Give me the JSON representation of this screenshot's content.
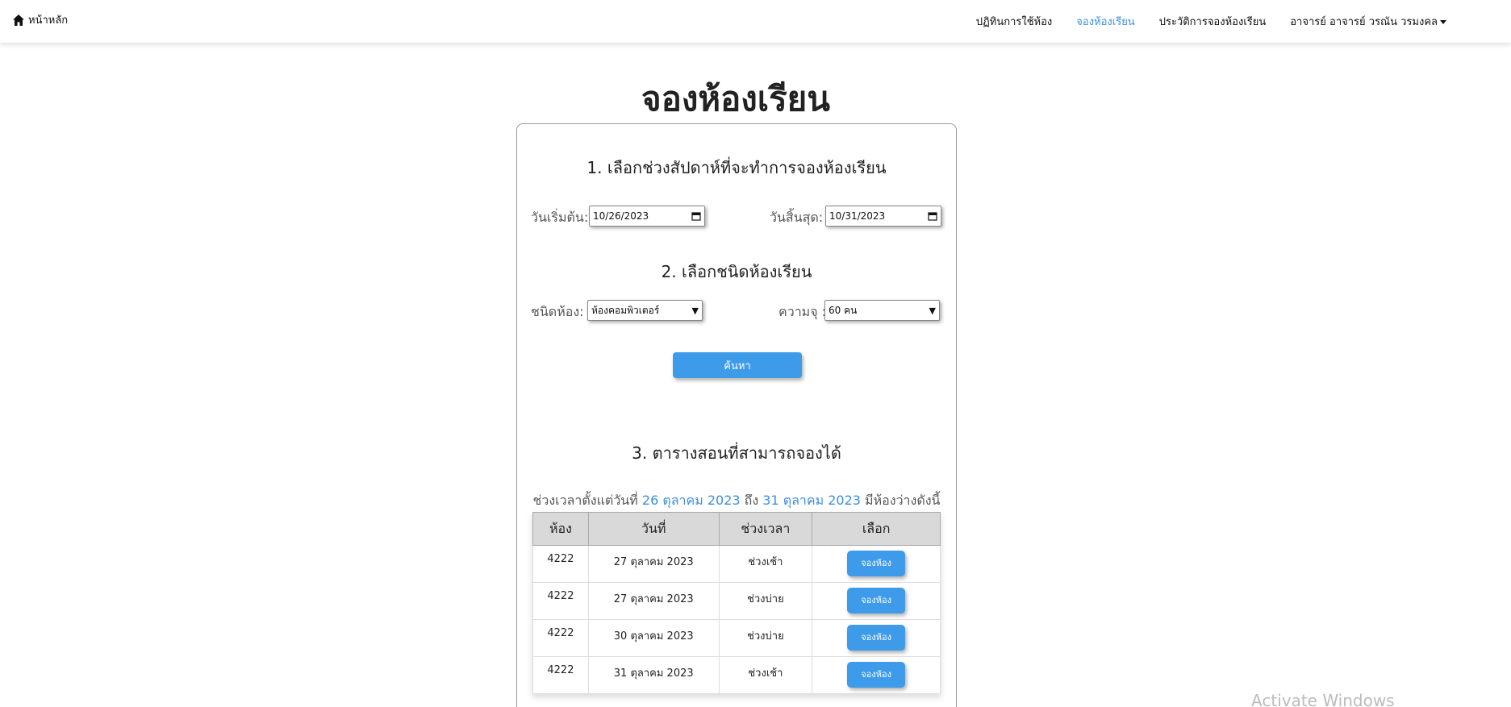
{
  "nav": {
    "brand": "หน้าหลัก",
    "links": [
      "ปฏิทินการใช้ห้อง",
      "จองห้องเรียน",
      "ประวัติการจองห้องเรียน"
    ],
    "user": "อาจารย์ อาจารย์ วรณัน วรมงคล",
    "active_color": "#3d8fe0"
  },
  "page_title": "จองห้องเรียน",
  "step1": {
    "title": "1. เลือกช่วงสัปดาห์ที่จะทำการจองห้องเรียน",
    "start_label": "วันเริ่มต้น:",
    "start_value": "10/26/2023",
    "end_label": "วันสิ้นสุด:",
    "end_value": "10/31/2023"
  },
  "step2": {
    "title": "2. เลือกชนิดห้องเรียน",
    "type_label": "ชนิดห้อง:",
    "type_value": "ห้องคอมพิวเตอร์",
    "capacity_label": "ความจุ :",
    "capacity_value": "60 คน",
    "search_label": "ค้นหา"
  },
  "step3": {
    "title": "3. ตารางสอนที่สามารถจองได้",
    "summary_prefix": "ช่วงเวลาตั้งแต่วันที่",
    "summary_start": "26 ตุลาคม 2023",
    "summary_mid": "ถึง",
    "summary_end": "31 ตุลาคม 2023",
    "summary_suffix": "มีห้องว่างดังนี้",
    "headers": [
      "ห้อง",
      "วันที่",
      "ช่วงเวลา",
      "เลือก"
    ],
    "rows": [
      {
        "room": "4222",
        "date": "27 ตุลาคม 2023",
        "period": "ช่วงเช้า",
        "action": "จองห้อง"
      },
      {
        "room": "4222",
        "date": "27 ตุลาคม 2023",
        "period": "ช่วงบ่าย",
        "action": "จองห้อง"
      },
      {
        "room": "4222",
        "date": "30 ตุลาคม 2023",
        "period": "ช่วงบ่าย",
        "action": "จองห้อง"
      },
      {
        "room": "4222",
        "date": "31 ตุลาคม 2023",
        "period": "ช่วงเช้า",
        "action": "จองห้อง"
      }
    ]
  },
  "watermark": "Activate Windows",
  "colors": {
    "accent": "#3d9be9",
    "header_bg": "#d9d9d9"
  }
}
